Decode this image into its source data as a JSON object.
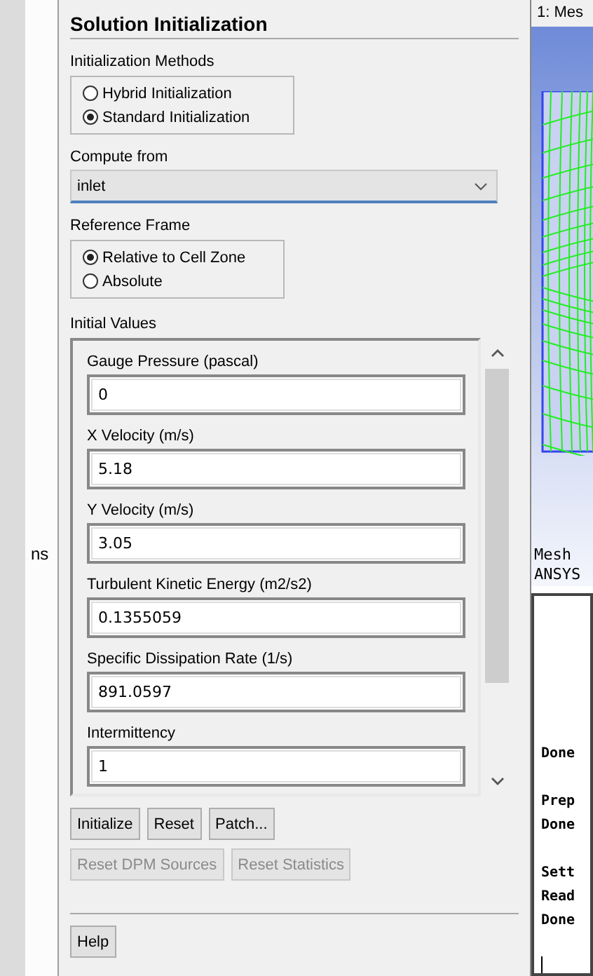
{
  "side_label": "ns",
  "panel": {
    "title": "Solution Initialization",
    "methods": {
      "label": "Initialization Methods",
      "options": [
        {
          "label": "Hybrid  Initialization",
          "selected": false
        },
        {
          "label": "Standard Initialization",
          "selected": true
        }
      ]
    },
    "compute_from": {
      "label": "Compute from",
      "value": "inlet"
    },
    "reference_frame": {
      "label": "Reference Frame",
      "options": [
        {
          "label": "Relative to Cell Zone",
          "selected": true
        },
        {
          "label": "Absolute",
          "selected": false
        }
      ]
    },
    "initial_values": {
      "label": "Initial Values",
      "fields": [
        {
          "label": "Gauge Pressure (pascal)",
          "value": "0"
        },
        {
          "label": "X Velocity (m/s)",
          "value": "5.18"
        },
        {
          "label": "Y Velocity (m/s)",
          "value": "3.05"
        },
        {
          "label": "Turbulent Kinetic Energy (m2/s2)",
          "value": "0.1355059"
        },
        {
          "label": "Specific Dissipation Rate (1/s)",
          "value": "891.0597"
        },
        {
          "label": "Intermittency",
          "value": "1"
        }
      ]
    },
    "buttons": [
      {
        "label": "Initialize",
        "disabled": false
      },
      {
        "label": "Reset",
        "disabled": false
      },
      {
        "label": "Patch...",
        "disabled": false
      }
    ],
    "secondary_buttons": [
      {
        "label": "Reset DPM Sources",
        "disabled": true
      },
      {
        "label": "Reset Statistics",
        "disabled": true
      }
    ],
    "help_button": "Help"
  },
  "graphics": {
    "title": "1: Mes",
    "legend": [
      "Mesh",
      "ANSYS"
    ]
  },
  "console": {
    "blocks": [
      [
        "Done"
      ],
      [
        "Prep",
        "Done"
      ],
      [
        "Sett",
        "Read",
        "Done"
      ]
    ]
  }
}
